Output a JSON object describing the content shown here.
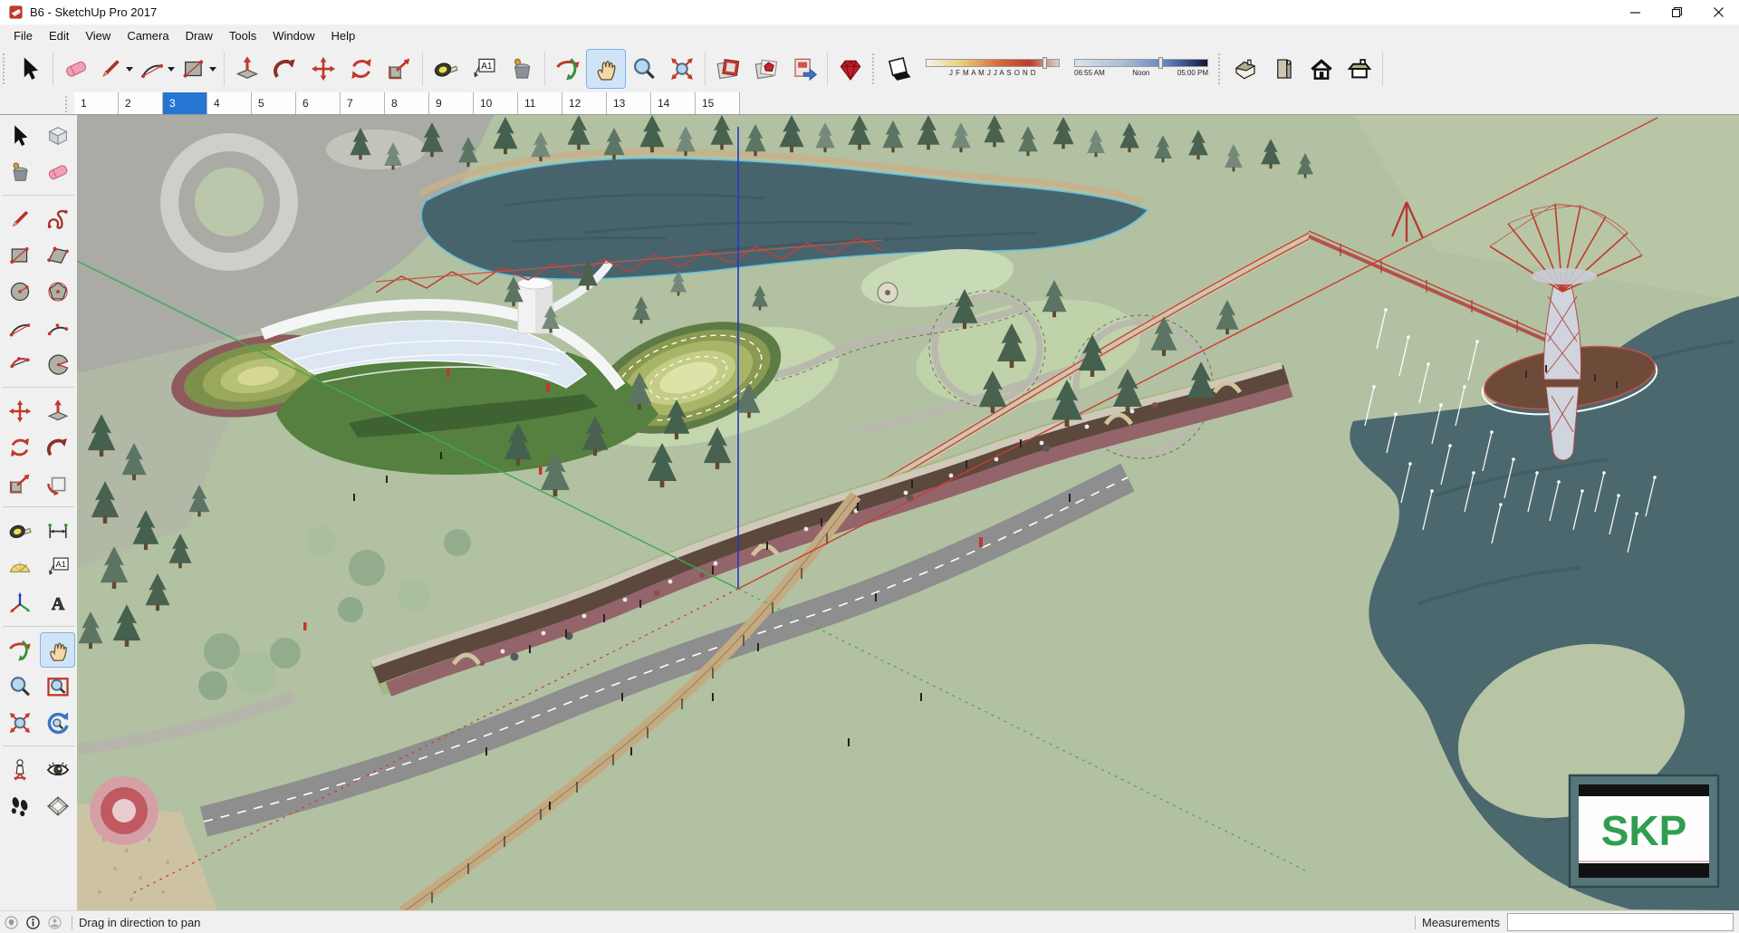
{
  "window": {
    "title": "B6 - SketchUp Pro 2017"
  },
  "menus": [
    "File",
    "Edit",
    "View",
    "Camera",
    "Draw",
    "Tools",
    "Window",
    "Help"
  ],
  "toolbar": {
    "text_tool_label": "A1",
    "threed_text_label": "A",
    "shadow": {
      "months": "J F M A M J J A S O N D",
      "time_start": "06:55 AM",
      "time_mid": "Noon",
      "time_end": "05:00 PM",
      "date_pos": 0.87,
      "time_pos": 0.63
    }
  },
  "scene_tabs": {
    "tabs": [
      "1",
      "2",
      "3",
      "4",
      "5",
      "6",
      "7",
      "8",
      "9",
      "10",
      "11",
      "12",
      "13",
      "14",
      "15"
    ],
    "selected": "3"
  },
  "statusbar": {
    "hint": "Drag in direction to pan",
    "measurements_label": "Measurements",
    "measurements_value": ""
  },
  "viewport": {
    "billboard_text": "SKP"
  },
  "colors": {
    "tab_selected_blue": "#2476d2",
    "tool_active_bg": "#cfe5f7",
    "toolbar_bg": "#f0f0f0",
    "lake_teal": "#47646d",
    "terrain_green": "#b2c1a1",
    "deck_brown": "#5c483c",
    "deck_maroon": "#93646a",
    "axis_red": "#cf3a30",
    "axis_green": "#3faa4e",
    "axis_blue": "#2438c8",
    "billboard_green": "#2f9e4f"
  }
}
